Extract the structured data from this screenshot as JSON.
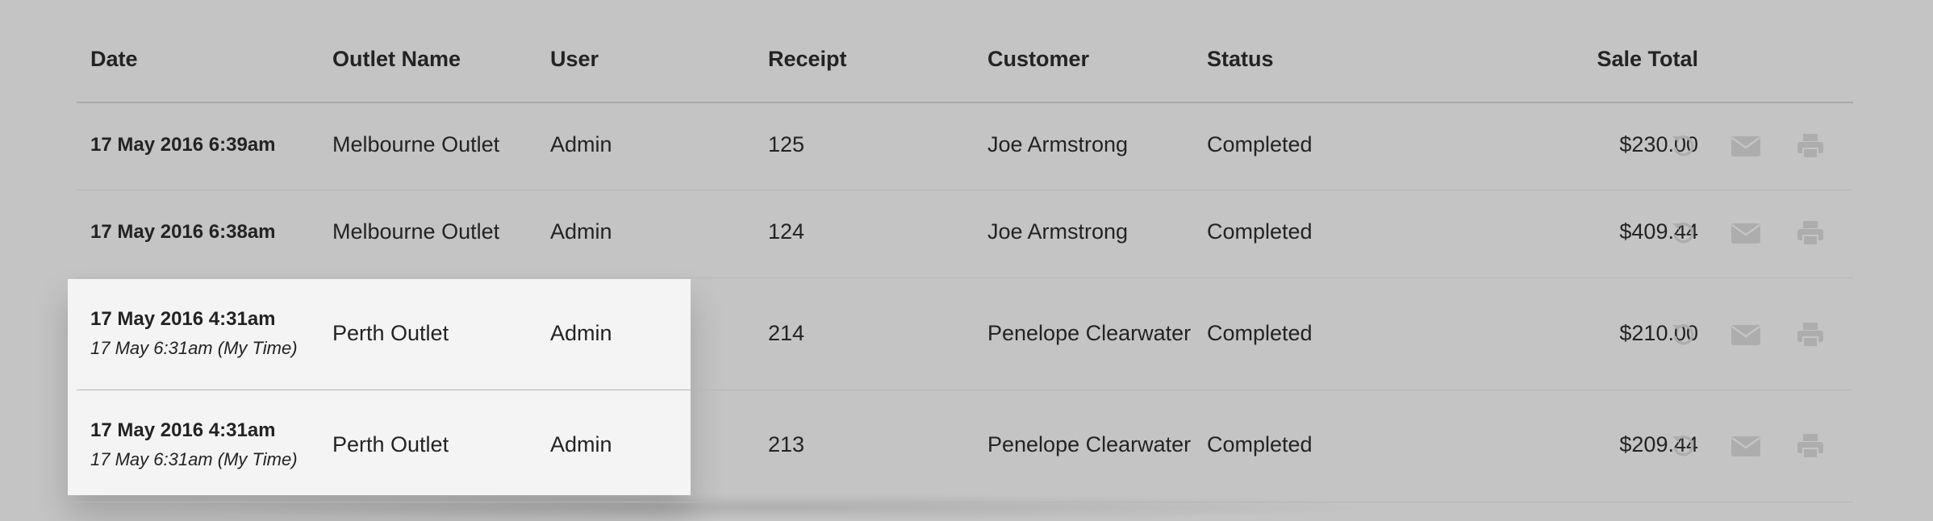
{
  "table": {
    "headers": {
      "date": "Date",
      "outlet": "Outlet Name",
      "user": "User",
      "receipt": "Receipt",
      "customer": "Customer",
      "status": "Status",
      "total": "Sale Total"
    },
    "rows": [
      {
        "date": "17 May 2016 6:39am",
        "date_sub": "",
        "outlet": "Melbourne Outlet",
        "user": "Admin",
        "receipt": "125",
        "customer": "Joe Armstrong",
        "status": "Completed",
        "total": "$230.00"
      },
      {
        "date": "17 May 2016 6:38am",
        "date_sub": "",
        "outlet": "Melbourne Outlet",
        "user": "Admin",
        "receipt": "124",
        "customer": "Joe Armstrong",
        "status": "Completed",
        "total": "$409.44"
      },
      {
        "date": "17 May 2016 4:31am",
        "date_sub": "17 May 6:31am (My Time)",
        "outlet": "Perth Outlet",
        "user": "Admin",
        "receipt": "214",
        "customer": "Penelope Clearwater",
        "status": "Completed",
        "total": "$210.00"
      },
      {
        "date": "17 May 2016 4:31am",
        "date_sub": "17 May 6:31am (My Time)",
        "outlet": "Perth Outlet",
        "user": "Admin",
        "receipt": "213",
        "customer": "Penelope Clearwater",
        "status": "Completed",
        "total": "$209.44"
      }
    ]
  },
  "icons": {
    "return": "return-icon",
    "email": "email-icon",
    "print": "print-icon",
    "color": "#adadad"
  }
}
